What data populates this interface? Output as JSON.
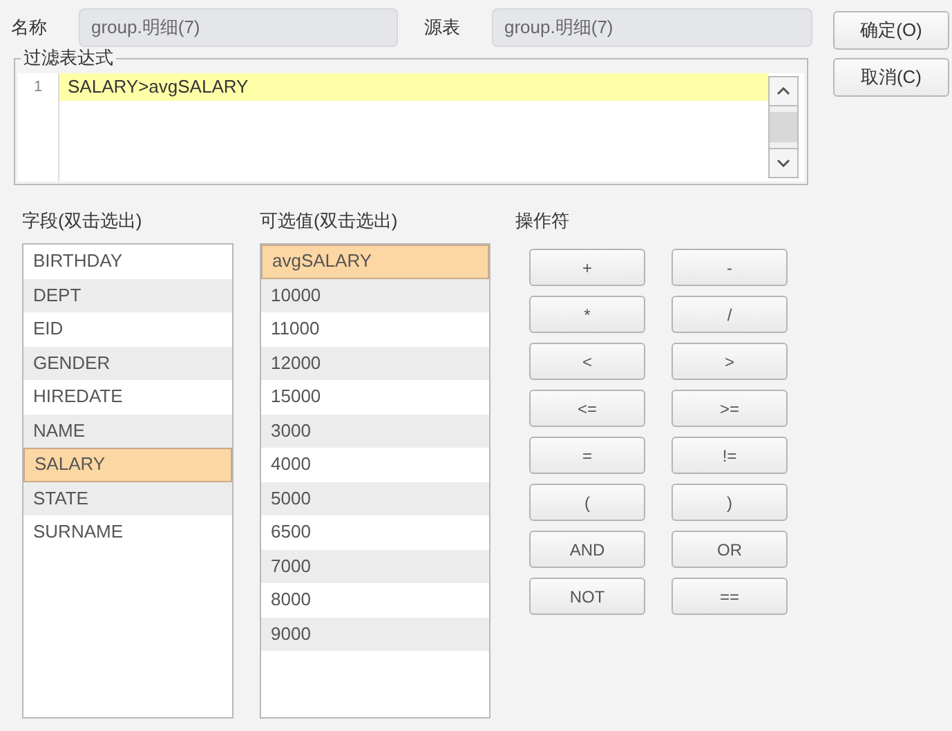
{
  "name_label": "名称",
  "name_value": "group.明细(7)",
  "source_label": "源表",
  "source_value": "group.明细(7)",
  "buttons": [
    {
      "label": "确定(O)"
    },
    {
      "label": "取消(C)"
    }
  ],
  "expression": {
    "legend": "过滤表达式",
    "lines": [
      {
        "number": "1",
        "text": "SALARY>avgSALARY",
        "highlighted": true
      }
    ]
  },
  "fields": {
    "label": "字段(双击选出)",
    "items": [
      {
        "text": "BIRTHDAY",
        "selected": false
      },
      {
        "text": "DEPT",
        "selected": false
      },
      {
        "text": "EID",
        "selected": false
      },
      {
        "text": "GENDER",
        "selected": false
      },
      {
        "text": "HIREDATE",
        "selected": false
      },
      {
        "text": "NAME",
        "selected": false
      },
      {
        "text": "SALARY",
        "selected": true
      },
      {
        "text": "STATE",
        "selected": false
      },
      {
        "text": "SURNAME",
        "selected": false
      }
    ]
  },
  "values": {
    "label": "可选值(双击选出)",
    "items": [
      {
        "text": "avgSALARY",
        "selected": true
      },
      {
        "text": "10000",
        "selected": false
      },
      {
        "text": "11000",
        "selected": false
      },
      {
        "text": "12000",
        "selected": false
      },
      {
        "text": "15000",
        "selected": false
      },
      {
        "text": "3000",
        "selected": false
      },
      {
        "text": "4000",
        "selected": false
      },
      {
        "text": "5000",
        "selected": false
      },
      {
        "text": "6500",
        "selected": false
      },
      {
        "text": "7000",
        "selected": false
      },
      {
        "text": "8000",
        "selected": false
      },
      {
        "text": "9000",
        "selected": false
      }
    ]
  },
  "operators": {
    "label": "操作符",
    "items": [
      "+",
      "-",
      "*",
      "/",
      "<",
      ">",
      "<=",
      ">=",
      "=",
      "!=",
      "(",
      ")",
      "AND",
      "OR",
      "NOT",
      "=="
    ]
  }
}
